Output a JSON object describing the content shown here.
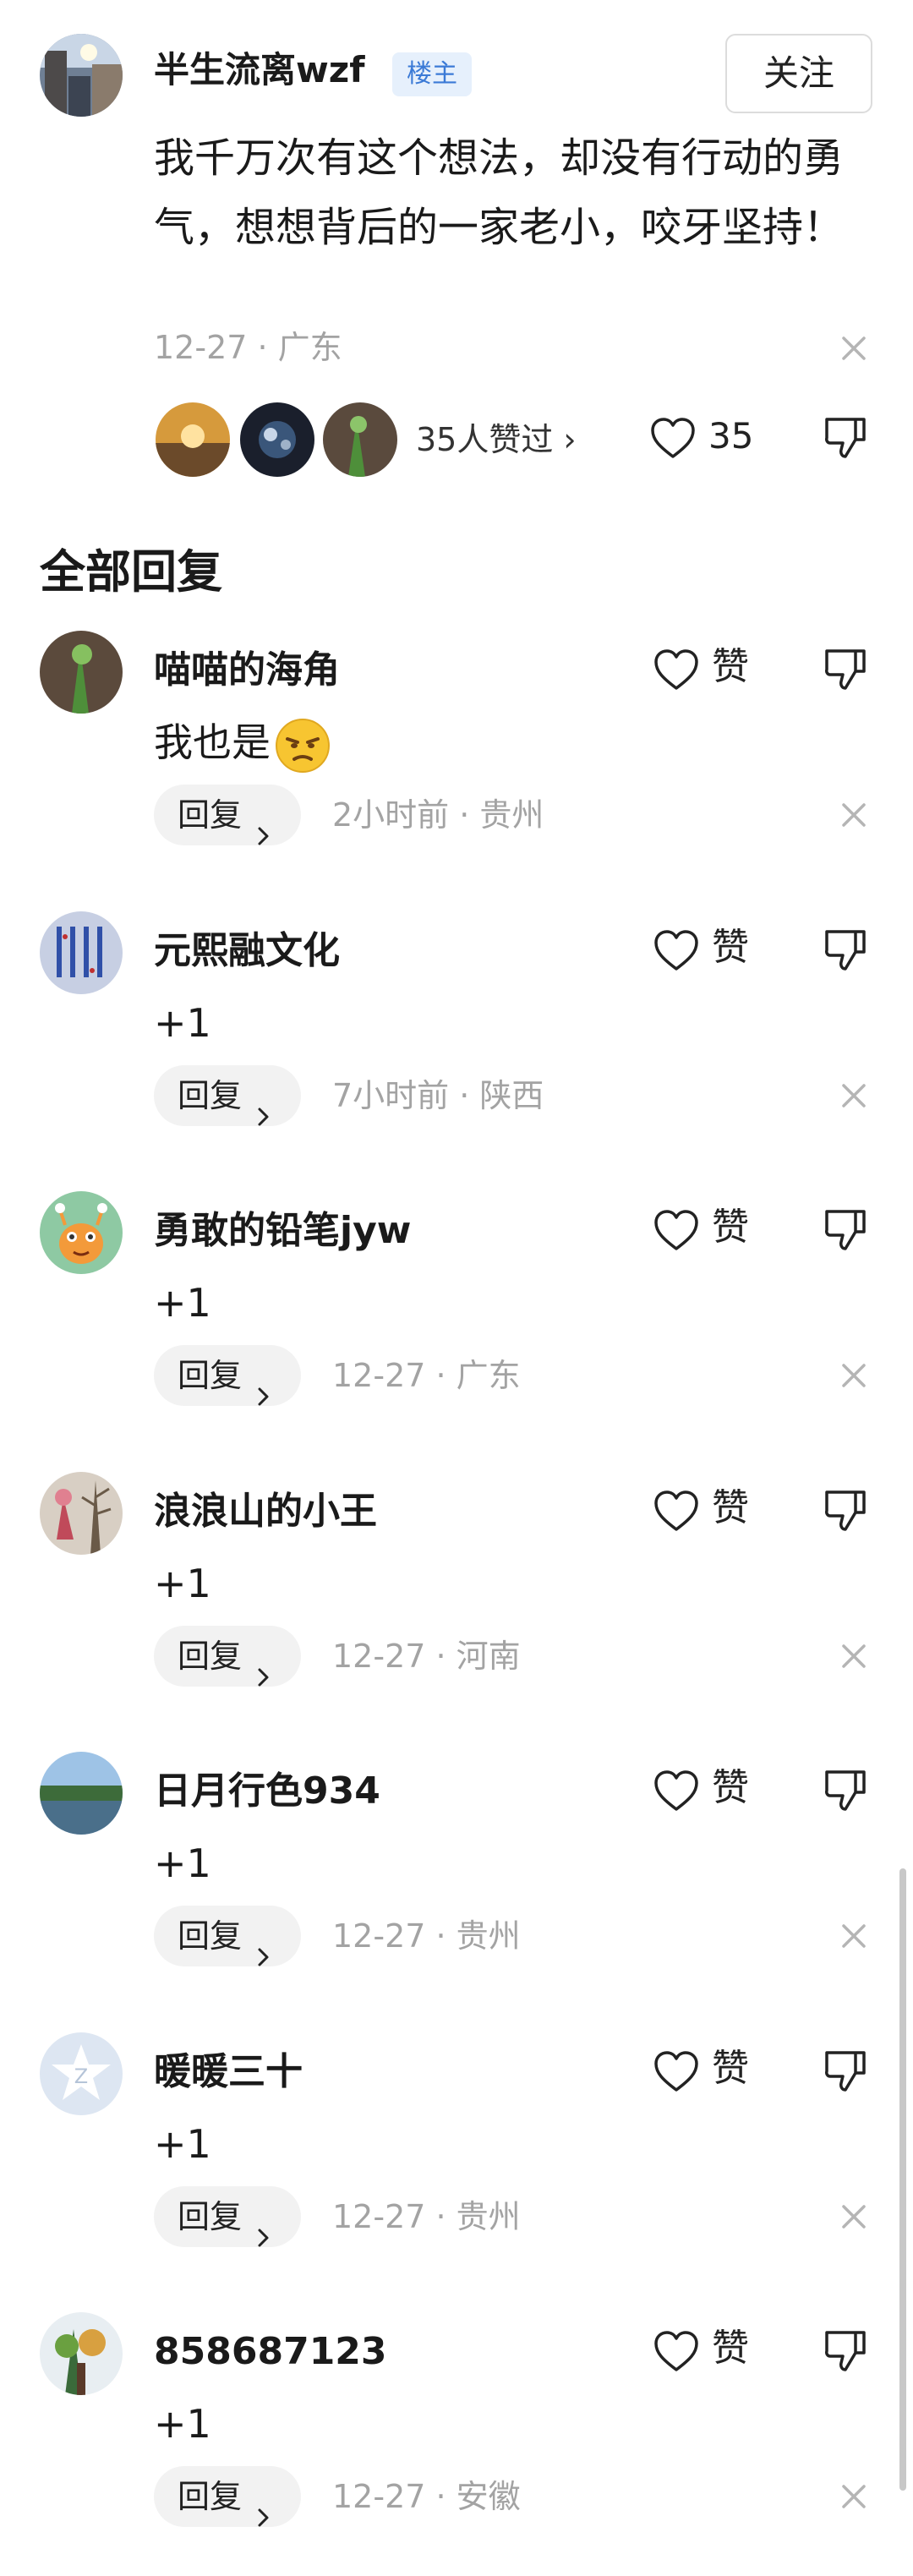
{
  "post": {
    "author": "半生流离wzf",
    "badge": "楼主",
    "follow_label": "关注",
    "text": "我千万次有这个想法，却没有行动的勇气，想想背后的一家老小，咬牙坚持！",
    "meta": "12-27 · 广东",
    "likers_text": "35人赞过 ›",
    "like_count": "35"
  },
  "section_title": "全部回复",
  "replies": [
    {
      "name": "喵喵的海角",
      "text": "我也是",
      "reply_label": "回复",
      "meta": "2小时前 · 贵州",
      "like_label": "赞",
      "emoji": "annoyed-face-emoji"
    },
    {
      "name": "元熙融文化",
      "text": "+1",
      "reply_label": "回复",
      "meta": "7小时前 · 陕西",
      "like_label": "赞"
    },
    {
      "name": "勇敢的铅笔jyw",
      "text": "+1",
      "reply_label": "回复",
      "meta": "12-27 · 广东",
      "like_label": "赞"
    },
    {
      "name": "浪浪山的小王",
      "text": "+1",
      "reply_label": "回复",
      "meta": "12-27 · 河南",
      "like_label": "赞"
    },
    {
      "name": "日月行色934",
      "text": "+1",
      "reply_label": "回复",
      "meta": "12-27 · 贵州",
      "like_label": "赞"
    },
    {
      "name": "暖暖三十",
      "text": "+1",
      "reply_label": "回复",
      "meta": "12-27 · 贵州",
      "like_label": "赞"
    },
    {
      "name": "858687123",
      "text": "+1",
      "reply_label": "回复",
      "meta": "12-27 · 安徽",
      "like_label": "赞"
    }
  ],
  "icons": {
    "heart": "heart-outline-icon",
    "dislike": "thumbs-down-icon",
    "close": "close-icon",
    "chevron": "chevron-right-icon"
  },
  "colors": {
    "badge_text": "#3b7ad6",
    "badge_bg": "#e6f0fc",
    "meta_text": "#a3a3a3",
    "reply_button_bg": "#f2f2f2"
  }
}
